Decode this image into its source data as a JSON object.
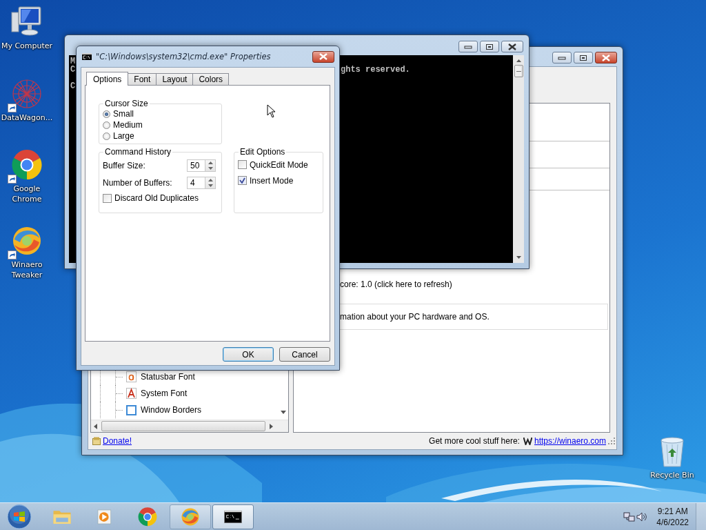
{
  "desktop_icons": [
    {
      "kind": "computer",
      "label": "My Computer",
      "shortcut": false
    },
    {
      "kind": "starburst",
      "label": "DataWagon...",
      "shortcut": true
    },
    {
      "kind": "browser",
      "label": "Google Chrome",
      "shortcut": true
    },
    {
      "kind": "swirl",
      "label": "Winaero Tweaker",
      "shortcut": true
    }
  ],
  "recycle_bin": {
    "label": "Recycle Bin"
  },
  "app_window": {
    "score_text": "core: 1.0 (click here to refresh)",
    "info_text": "mation about your PC hardware and OS.",
    "tree_items": [
      {
        "kind": "small-font",
        "label": "Statusbar Font"
      },
      {
        "kind": "large-font",
        "label": "System Font"
      },
      {
        "kind": "border",
        "label": "Window Borders"
      }
    ],
    "status_bar": {
      "donate": "Donate!",
      "promo": "Get more cool stuff here:",
      "link": "https://winaero.com"
    }
  },
  "console_window": {
    "lines": [
      {
        "left": "M"
      },
      {
        "left": "C",
        "right": "ghts reserved."
      },
      {
        "left": "C"
      }
    ]
  },
  "dialog": {
    "title": "\"C:\\Windows\\system32\\cmd.exe\" Properties",
    "tabs": [
      {
        "label": "Options",
        "selected": true
      },
      {
        "label": "Font",
        "selected": false
      },
      {
        "label": "Layout",
        "selected": false
      },
      {
        "label": "Colors",
        "selected": false
      }
    ],
    "cursor_size": {
      "title": "Cursor Size",
      "options": [
        {
          "label": "Small",
          "selected": true
        },
        {
          "label": "Medium",
          "selected": false
        },
        {
          "label": "Large",
          "selected": false
        }
      ]
    },
    "command_history": {
      "title": "Command History",
      "fields": [
        {
          "label": "Buffer Size:",
          "value": "50"
        },
        {
          "label": "Number of Buffers:",
          "value": "4"
        }
      ],
      "discard": {
        "label": "Discard Old Duplicates",
        "checked": false
      }
    },
    "edit_options": {
      "title": "Edit Options",
      "checkboxes": [
        {
          "label": "QuickEdit Mode",
          "checked": false
        },
        {
          "label": "Insert Mode",
          "checked": true
        }
      ]
    },
    "buttons": [
      {
        "label": "OK",
        "default": true
      },
      {
        "label": "Cancel",
        "default": false
      }
    ]
  },
  "taskbar": {
    "apps": [
      {
        "kind": "folder",
        "open": false,
        "selected": false
      },
      {
        "kind": "media",
        "open": false,
        "selected": false
      },
      {
        "kind": "browser",
        "open": false,
        "selected": false
      },
      {
        "kind": "swirl",
        "open": true,
        "selected": false
      },
      {
        "kind": "console",
        "open": true,
        "selected": true
      }
    ],
    "time": "9:21 AM",
    "date": "4/6/2022"
  }
}
